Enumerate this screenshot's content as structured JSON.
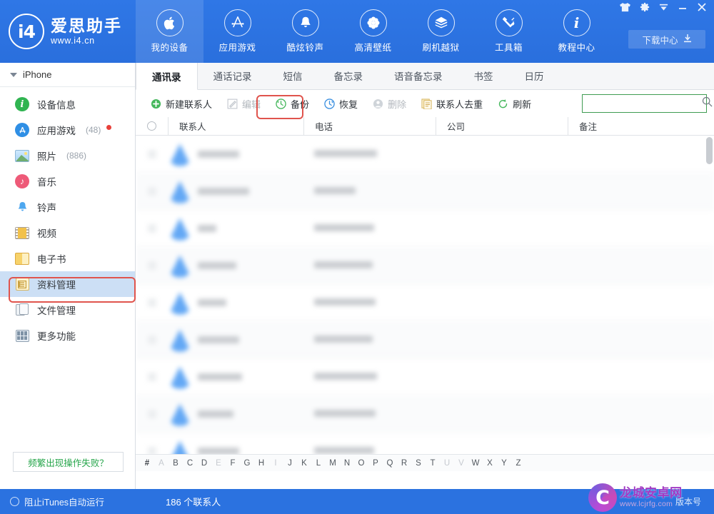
{
  "app": {
    "brand_cn": "爱思助手",
    "brand_url": "www.i4.cn"
  },
  "topnav": {
    "items": [
      {
        "label": "我的设备",
        "icon": "apple-icon",
        "active": true
      },
      {
        "label": "应用游戏",
        "icon": "appstore-icon",
        "active": false
      },
      {
        "label": "酷炫铃声",
        "icon": "bell-icon",
        "active": false
      },
      {
        "label": "高清壁纸",
        "icon": "flower-icon",
        "active": false
      },
      {
        "label": "刷机越狱",
        "icon": "box-icon",
        "active": false
      },
      {
        "label": "工具箱",
        "icon": "tools-icon",
        "active": false
      },
      {
        "label": "教程中心",
        "icon": "info-icon",
        "active": false
      }
    ],
    "download_center": "下载中心"
  },
  "window_controls": [
    {
      "name": "skin-icon"
    },
    {
      "name": "gear-icon"
    },
    {
      "name": "chevron-down-icon"
    },
    {
      "name": "minimize-icon"
    },
    {
      "name": "close-icon"
    }
  ],
  "sidebar": {
    "device": "iPhone",
    "items": [
      {
        "label": "设备信息",
        "icon": "info-circle-icon",
        "count": "",
        "dot": false,
        "selected": false
      },
      {
        "label": "应用游戏",
        "icon": "appstore-icon",
        "count": "(48)",
        "dot": true,
        "selected": false
      },
      {
        "label": "照片",
        "icon": "photo-icon",
        "count": "(886)",
        "dot": false,
        "selected": false
      },
      {
        "label": "音乐",
        "icon": "music-icon",
        "count": "",
        "dot": false,
        "selected": false
      },
      {
        "label": "铃声",
        "icon": "bell-icon",
        "count": "",
        "dot": false,
        "selected": false
      },
      {
        "label": "视频",
        "icon": "video-icon",
        "count": "",
        "dot": false,
        "selected": false
      },
      {
        "label": "电子书",
        "icon": "book-icon",
        "count": "",
        "dot": false,
        "selected": false
      },
      {
        "label": "资料管理",
        "icon": "data-icon",
        "count": "",
        "dot": false,
        "selected": true
      },
      {
        "label": "文件管理",
        "icon": "file-icon",
        "count": "",
        "dot": false,
        "selected": false
      },
      {
        "label": "更多功能",
        "icon": "grid-icon",
        "count": "",
        "dot": false,
        "selected": false
      }
    ],
    "help_link": "频繁出现操作失败？"
  },
  "tabs": [
    {
      "label": "通讯录",
      "active": true
    },
    {
      "label": "通话记录",
      "active": false
    },
    {
      "label": "短信",
      "active": false
    },
    {
      "label": "备忘录",
      "active": false
    },
    {
      "label": "语音备忘录",
      "active": false
    },
    {
      "label": "书签",
      "active": false
    },
    {
      "label": "日历",
      "active": false
    }
  ],
  "toolbar": {
    "buttons": [
      {
        "label": "新建联系人",
        "icon": "plus-circle-icon",
        "disabled": false,
        "highlighted": false
      },
      {
        "label": "编辑",
        "icon": "pencil-icon",
        "disabled": true,
        "highlighted": false
      },
      {
        "label": "备份",
        "icon": "backup-icon",
        "disabled": false,
        "highlighted": true
      },
      {
        "label": "恢复",
        "icon": "restore-icon",
        "disabled": false,
        "highlighted": false
      },
      {
        "label": "删除",
        "icon": "delete-icon",
        "disabled": true,
        "highlighted": false
      },
      {
        "label": "联系人去重",
        "icon": "dedupe-icon",
        "disabled": false,
        "highlighted": false
      },
      {
        "label": "刷新",
        "icon": "refresh-icon",
        "disabled": false,
        "highlighted": false
      }
    ]
  },
  "search": {
    "value": "",
    "placeholder": ""
  },
  "table": {
    "columns": [
      "联系人",
      "电话",
      "公司",
      "备注"
    ],
    "rows": [
      {
        "name": "",
        "phone": "",
        "company": "",
        "note": ""
      },
      {
        "name": "",
        "phone": "",
        "company": "",
        "note": ""
      },
      {
        "name": "",
        "phone": "",
        "company": "",
        "note": ""
      },
      {
        "name": "",
        "phone": "",
        "company": "",
        "note": ""
      },
      {
        "name": "",
        "phone": "",
        "company": "",
        "note": ""
      },
      {
        "name": "",
        "phone": "",
        "company": "",
        "note": ""
      },
      {
        "name": "",
        "phone": "",
        "company": "",
        "note": ""
      },
      {
        "name": "",
        "phone": "",
        "company": "",
        "note": ""
      },
      {
        "name": "",
        "phone": "",
        "company": "",
        "note": ""
      }
    ]
  },
  "alpha_index": [
    {
      "ch": "#",
      "dim": false
    },
    {
      "ch": "A",
      "dim": true
    },
    {
      "ch": "B",
      "dim": false
    },
    {
      "ch": "C",
      "dim": false
    },
    {
      "ch": "D",
      "dim": false
    },
    {
      "ch": "E",
      "dim": true
    },
    {
      "ch": "F",
      "dim": false
    },
    {
      "ch": "G",
      "dim": false
    },
    {
      "ch": "H",
      "dim": false
    },
    {
      "ch": "I",
      "dim": true
    },
    {
      "ch": "J",
      "dim": false
    },
    {
      "ch": "K",
      "dim": false
    },
    {
      "ch": "L",
      "dim": false
    },
    {
      "ch": "M",
      "dim": false
    },
    {
      "ch": "N",
      "dim": false
    },
    {
      "ch": "O",
      "dim": false
    },
    {
      "ch": "P",
      "dim": false
    },
    {
      "ch": "Q",
      "dim": false
    },
    {
      "ch": "R",
      "dim": false
    },
    {
      "ch": "S",
      "dim": false
    },
    {
      "ch": "T",
      "dim": false
    },
    {
      "ch": "U",
      "dim": true
    },
    {
      "ch": "V",
      "dim": true
    },
    {
      "ch": "W",
      "dim": false
    },
    {
      "ch": "X",
      "dim": false
    },
    {
      "ch": "Y",
      "dim": false
    },
    {
      "ch": "Z",
      "dim": false
    }
  ],
  "statusbar": {
    "itunes_toggle": "阻止iTunes自动运行",
    "contact_count": "186 个联系人",
    "version": "版本号"
  },
  "watermark": {
    "logo_letter": "C",
    "site_cn": "龙城安卓网",
    "site_url": "www.lcjrfg.com"
  },
  "colors": {
    "brand_blue": "#2b72e0",
    "accent_green": "#3f9c52",
    "annotation_red": "#e0544d",
    "selected_blue": "#ccdff5"
  }
}
